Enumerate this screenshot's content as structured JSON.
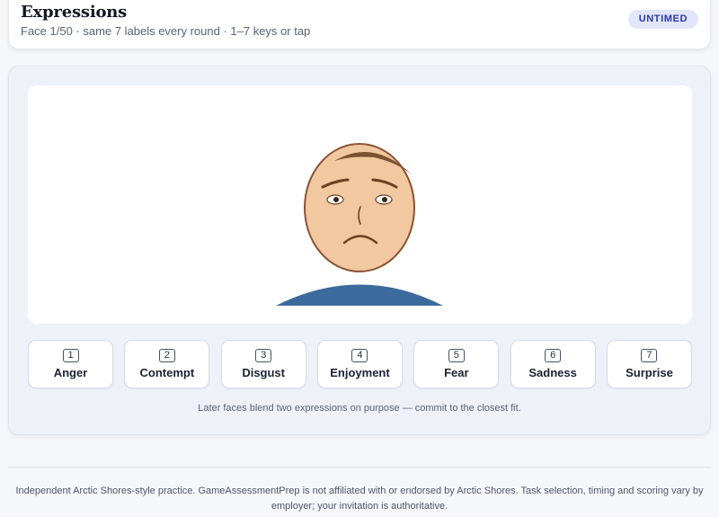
{
  "header": {
    "title": "Expressions",
    "subtitle": "Face 1/50 · same 7 labels every round · 1–7 keys or tap",
    "badge": "UNTIMED"
  },
  "stimulus": {
    "shown_expression": "sad-face",
    "colors": {
      "skin": "#f2c8a0",
      "outline": "#8a5235",
      "hair": "#7b5330",
      "shirt": "#3b6b9c",
      "features": "#6b4020"
    }
  },
  "options": [
    {
      "key": "1",
      "label": "Anger"
    },
    {
      "key": "2",
      "label": "Contempt"
    },
    {
      "key": "3",
      "label": "Disgust"
    },
    {
      "key": "4",
      "label": "Enjoyment"
    },
    {
      "key": "5",
      "label": "Fear"
    },
    {
      "key": "6",
      "label": "Sadness"
    },
    {
      "key": "7",
      "label": "Surprise"
    }
  ],
  "hint": "Later faces blend two expressions on purpose — commit to the closest fit.",
  "footer": {
    "line1": "Independent Arctic Shores-style practice. GameAssessmentPrep is not affiliated with or endorsed by Arctic Shores. Task selection, timing and scoring vary by",
    "line2": "employer; your invitation is authoritative."
  }
}
